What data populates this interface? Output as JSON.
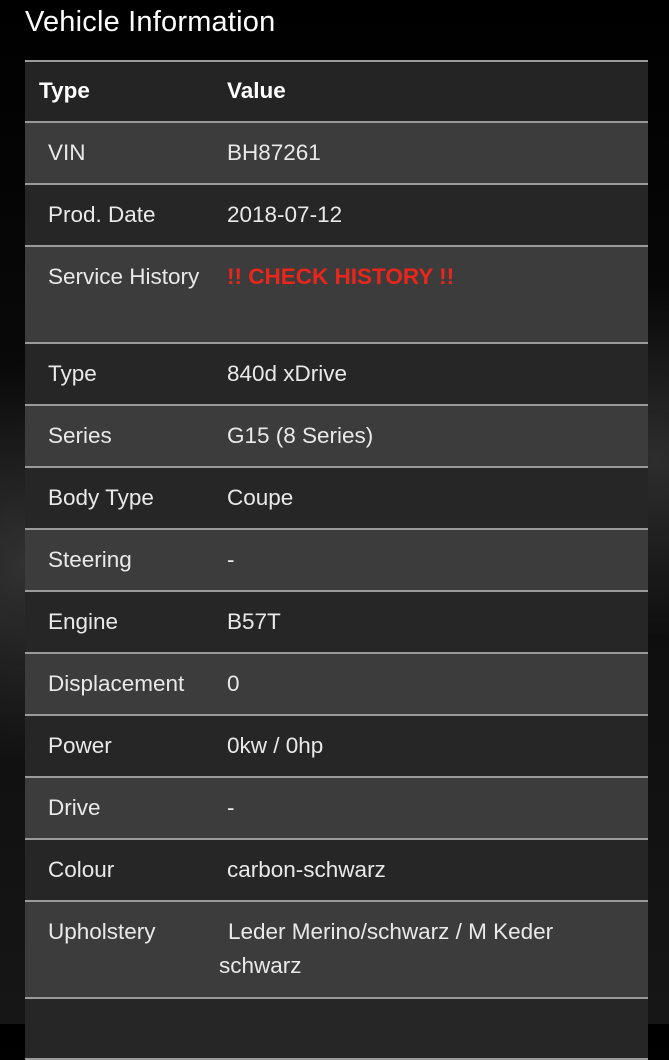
{
  "page": {
    "title": "Vehicle Information"
  },
  "table": {
    "headers": [
      "Type",
      "Value"
    ],
    "rows": [
      {
        "key": "VIN",
        "value": "BH87261"
      },
      {
        "key": "Prod. Date",
        "value": "2018-07-12"
      },
      {
        "key": "Service History",
        "value": "!! CHECK HISTORY !!",
        "warning": true
      },
      {
        "key": "Type",
        "value": "840d xDrive"
      },
      {
        "key": "Series",
        "value": "G15 (8 Series)"
      },
      {
        "key": "Body Type",
        "value": "Coupe"
      },
      {
        "key": "Steering",
        "value": "-"
      },
      {
        "key": "Engine",
        "value": "B57T"
      },
      {
        "key": "Displacement",
        "value": "0"
      },
      {
        "key": "Power",
        "value": "0kw / 0hp"
      },
      {
        "key": "Drive",
        "value": "-"
      },
      {
        "key": "Colour",
        "value": "carbon-schwarz"
      },
      {
        "key": "Upholstery",
        "value": "Leder Merino/schwarz / M Keder schwarz"
      }
    ]
  },
  "colors": {
    "warning": "#e8261c",
    "row_odd": "#3c3c3c",
    "row_even": "#262626",
    "header_bg": "#242424",
    "divider": "#9a9a9a"
  }
}
